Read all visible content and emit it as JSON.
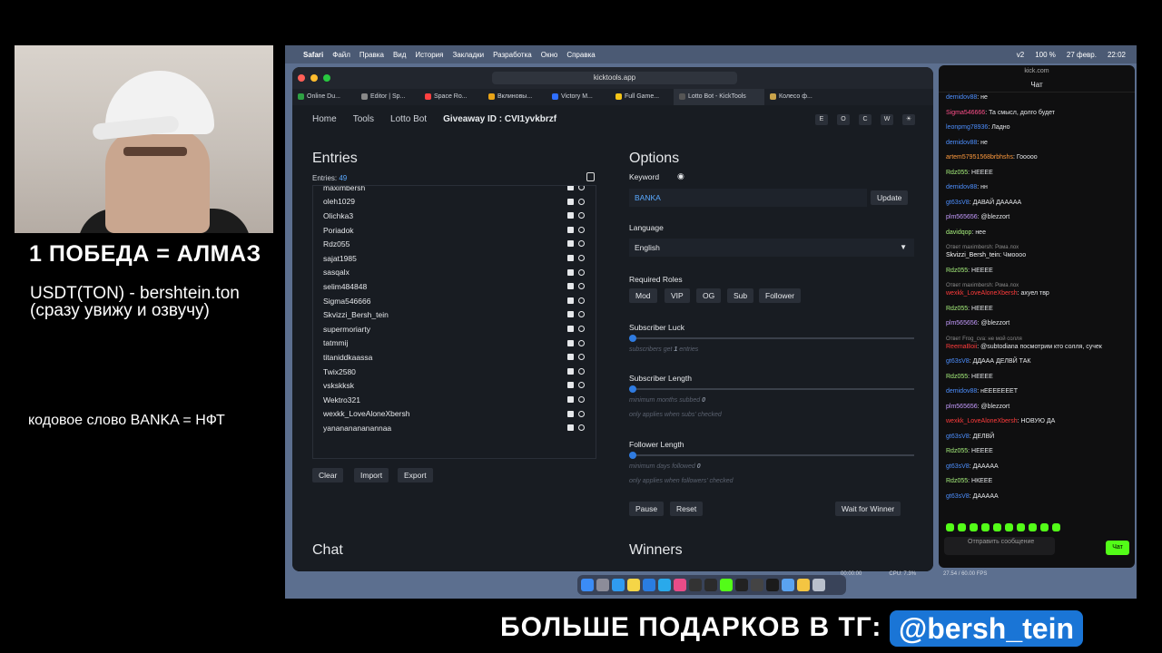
{
  "overlay": {
    "title": "1 ПОБЕДА = АЛМАЗ",
    "usdt": "USDT(TON) - bershtein.ton (сразу увижу и озвучу)",
    "code": "кодовое слово BANKA = НФТ",
    "bottom": "БОЛЬШЕ ПОДАРКОВ В ТГ:",
    "handle": "@bersh_tein"
  },
  "menubar": {
    "app": "Safari",
    "items": [
      "Файл",
      "Правка",
      "Вид",
      "История",
      "Закладки",
      "Разработка",
      "Окно",
      "Справка"
    ],
    "right": [
      "v2",
      "100 %",
      "27 февр.",
      "22:02"
    ]
  },
  "browser": {
    "url": "kicktools.app",
    "tabs": [
      "Online Du...",
      "Editor | Sp...",
      "Space Ro...",
      "Вклиновы...",
      "Victory M...",
      "Full Game...",
      "Lotto Bot - KickTools",
      "Колесо ф..."
    ],
    "tab_colors": [
      "#2ea043",
      "#888888",
      "#ff4040",
      "#e8a317",
      "#2f6fff",
      "#f5c518",
      "#1c2027",
      "#c8a24a"
    ]
  },
  "page": {
    "nav": [
      "Home",
      "Tools",
      "Lotto Bot"
    ],
    "giveaway_label": "Giveaway ID :",
    "giveaway_id": "CVI1yvkbrzf",
    "theme_buttons": [
      "E",
      "O",
      "C",
      "W",
      "☀"
    ],
    "entries_title": "Entries",
    "entries_label": "Entries:",
    "entries_count": "49",
    "entries": [
      "maximbersh",
      "oleh1029",
      "Olichka3",
      "Poriadok",
      "Rdz055",
      "sajat1985",
      "sasqalx",
      "selim484848",
      "Sigma546666",
      "Skvizzi_Bersh_tein",
      "supermoriarty",
      "tatmmij",
      "titaniddkaassa",
      "Twix2580",
      "vskskksk",
      "Wektro321",
      "wexkk_LoveAloneXbersh",
      "yanananananannaa"
    ],
    "buttons": {
      "clear": "Clear",
      "import": "Import",
      "export": "Export"
    },
    "chat_title": "Chat",
    "options_title": "Options",
    "keyword_label": "Keyword",
    "keyword_value": "BANKA",
    "update_label": "Update",
    "language_label": "Language",
    "language_value": "English",
    "roles_label": "Required Roles",
    "roles": [
      "Mod",
      "VIP",
      "OG",
      "Sub",
      "Follower"
    ],
    "sub_luck_label": "Subscriber Luck",
    "sub_luck_hint_pre": "subscribers get",
    "sub_luck_value": "1",
    "sub_luck_hint_post": "entries",
    "sub_length_label": "Subscriber Length",
    "sub_length_hint": "minimum months subbed",
    "sub_length_value": "0",
    "sub_length_note": "only applies when subs' checked",
    "fol_length_label": "Follower Length",
    "fol_length_hint": "minimum days followed",
    "fol_length_value": "0",
    "fol_length_note": "only applies when followers' checked",
    "pause_label": "Pause",
    "reset_label": "Reset",
    "wait_label": "Wait for Winner",
    "winners_title": "Winners"
  },
  "chat": {
    "site": "kick.com",
    "title": "Чат",
    "input_placeholder": "Отправить сообщение",
    "send_label": "Чат",
    "messages": [
      {
        "user": "demidov88",
        "text": "не",
        "color": "u-blue"
      },
      {
        "user": "Sigma546666",
        "text": "Та смысл, долго будет",
        "color": "u-pink"
      },
      {
        "user": "leonpmg78936",
        "text": "Ладно",
        "color": "u-blue"
      },
      {
        "user": "demidov88",
        "text": "не",
        "color": "u-blue"
      },
      {
        "user": "artem57951568brbhshs",
        "text": "Гоoooo",
        "color": "u-orange"
      },
      {
        "user": "Rdz055",
        "text": "НЕЕЕЕ",
        "color": "u-green"
      },
      {
        "user": "demidov88",
        "text": "нн",
        "color": "u-blue"
      },
      {
        "user": "gt63sV8",
        "text": "ДАВАЙ ДААААА",
        "color": "u-blue"
      },
      {
        "user": "plm565656",
        "text": "@blezzort",
        "color": "u-purple"
      },
      {
        "user": "davidqop",
        "text": "нее",
        "color": "u-green"
      },
      {
        "user": "Skvizzi_Bersh_tein",
        "text": "Чмоооо",
        "color": "u-white",
        "sys": "Ответ maximbersh: Рома лох"
      },
      {
        "user": "Rdz055",
        "text": "НЕЕЕЕ",
        "color": "u-green"
      },
      {
        "user": "wexkk_LoveAloneXbersh",
        "text": "ахуел твр",
        "color": "u-red",
        "sys": "Ответ maximbersh: Рома лох"
      },
      {
        "user": "Rdz055",
        "text": "НЕЕЕЕ",
        "color": "u-green"
      },
      {
        "user": "plm565656",
        "text": "@blezzort",
        "color": "u-purple"
      },
      {
        "user": "ReemaBoii",
        "text": "@subtodiana посмотрим кто солля, сучек",
        "color": "u-red",
        "sys": "Ответ Frog_cva: не мой солля"
      },
      {
        "user": "gt63sV8",
        "text": "ДДААА ДЕЛВЙ ТАК",
        "color": "u-blue"
      },
      {
        "user": "Rdz055",
        "text": "НЕЕЕЕ",
        "color": "u-green"
      },
      {
        "user": "demidov88",
        "text": "нЕЕЕЕЕЕЕТ",
        "color": "u-blue"
      },
      {
        "user": "plm565656",
        "text": "@blezzort",
        "color": "u-purple"
      },
      {
        "user": "wexkk_LoveAloneXbersh",
        "text": "НОВУЮ ДА",
        "color": "u-red"
      },
      {
        "user": "gt63sV8",
        "text": "ДЕЛВЙ",
        "color": "u-blue"
      },
      {
        "user": "Rdz055",
        "text": "НЕЕЕЕ",
        "color": "u-green"
      },
      {
        "user": "gt63sV8",
        "text": "ДААААА",
        "color": "u-blue"
      },
      {
        "user": "Rdz055",
        "text": "НКЕЕЕ",
        "color": "u-green"
      },
      {
        "user": "gt63sV8",
        "text": "ДААААА",
        "color": "u-blue"
      }
    ]
  },
  "statusbar": [
    "00:00:00",
    "CPU: 7.3%",
    "27.54 / 60.00 FPS"
  ]
}
